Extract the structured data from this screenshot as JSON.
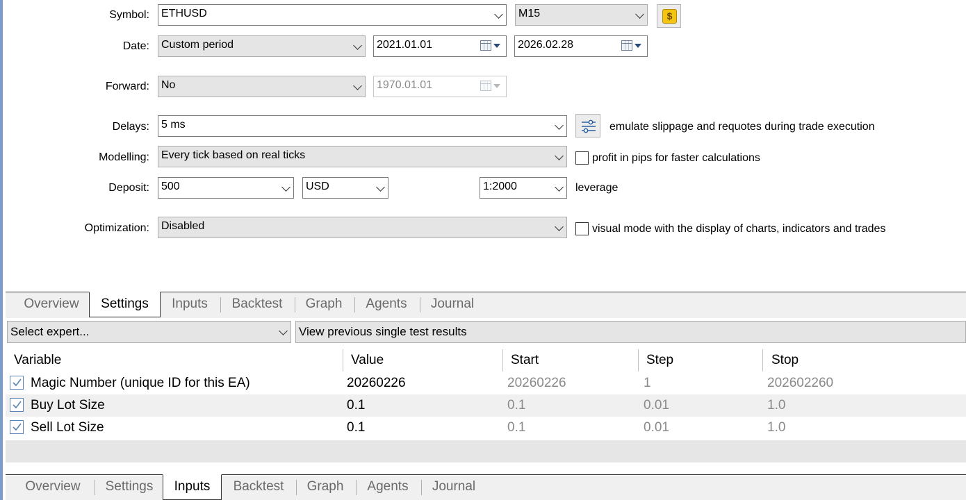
{
  "symbol": {
    "label": "Symbol:",
    "value": "ETHUSD",
    "timeframe": "M15",
    "symbol_icon": "dollar-coin-icon"
  },
  "date": {
    "label": "Date:",
    "mode": "Custom period",
    "from": "2021.01.01",
    "to": "2026.02.28"
  },
  "forward": {
    "label": "Forward:",
    "mode": "No",
    "date": "1970.01.01"
  },
  "delays": {
    "label": "Delays:",
    "value": "5 ms",
    "hint": "emulate slippage and requotes during trade execution"
  },
  "modelling": {
    "label": "Modelling:",
    "value": "Every tick based on real ticks",
    "option_label": "profit in pips for faster calculations",
    "option_checked": false
  },
  "deposit": {
    "label": "Deposit:",
    "amount": "500",
    "currency": "USD",
    "leverage": "1:2000",
    "leverage_label": "leverage"
  },
  "optimization": {
    "label": "Optimization:",
    "value": "Disabled",
    "option_label": "visual mode with the display of charts, indicators and trades",
    "option_checked": false
  },
  "tabs_top": {
    "active": "Settings",
    "items": [
      "Overview",
      "Settings",
      "Inputs",
      "Backtest",
      "Graph",
      "Agents",
      "Journal"
    ]
  },
  "expert": {
    "placeholder": "Select expert...",
    "results_button": "View previous single test results"
  },
  "params_table": {
    "headers": [
      "Variable",
      "Value",
      "Start",
      "Step",
      "Stop"
    ],
    "rows": [
      {
        "checked": true,
        "variable": "Magic Number (unique ID for this EA)",
        "value": "20260226",
        "start": "20260226",
        "step": "1",
        "stop": "202602260"
      },
      {
        "checked": true,
        "variable": "Buy Lot Size",
        "value": "0.1",
        "start": "0.1",
        "step": "0.01",
        "stop": "1.0"
      },
      {
        "checked": true,
        "variable": "Sell Lot Size",
        "value": "0.1",
        "start": "0.1",
        "step": "0.01",
        "stop": "1.0"
      }
    ]
  },
  "tabs_bottom": {
    "active": "Inputs",
    "items": [
      "Overview",
      "Settings",
      "Inputs",
      "Backtest",
      "Graph",
      "Agents",
      "Journal"
    ]
  },
  "colors": {
    "active_tab_bg": "#ffffff",
    "inactive_tab_text": "#6a6a6a",
    "coin_yellow": "#f3c512",
    "checkbox_blue": "#5c83b4"
  }
}
